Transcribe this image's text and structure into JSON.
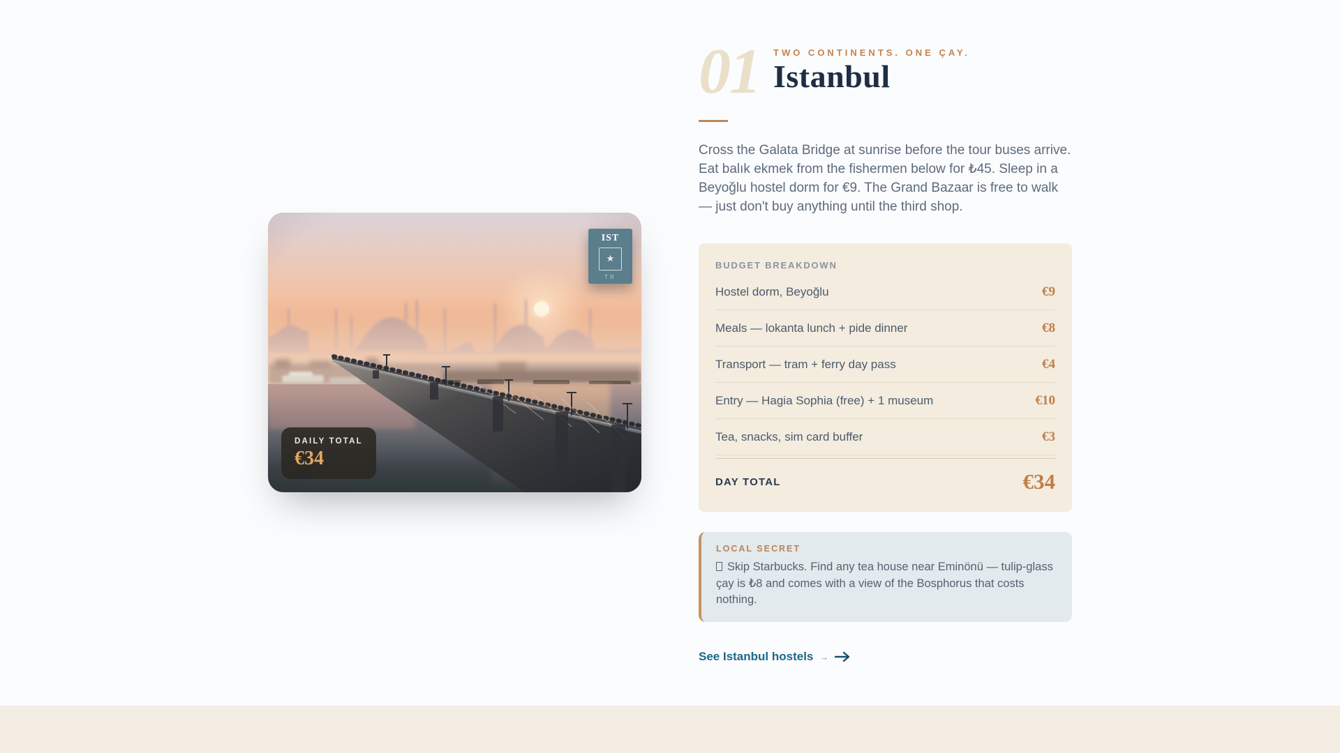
{
  "hero": {
    "index": "01",
    "kicker": "TWO CONTINENTS. ONE ÇAY.",
    "title": "Istanbul",
    "description": "Cross the Galata Bridge at sunrise before the tour buses arrive. Eat balık ekmek from the fishermen below for ₺45. Sleep in a Beyoğlu hostel dorm for €9. The Grand Bazaar is free to walk — just don't buy anything until the third shop."
  },
  "photo": {
    "alt": "Galata Bridge at hazy sunrise with mosque skyline and fishermen",
    "stamp": {
      "city_code": "IST",
      "star": "★",
      "country_code": "TR"
    },
    "overlay": {
      "label": "DAILY TOTAL",
      "amount": "€34"
    }
  },
  "budget": {
    "heading": "BUDGET BREAKDOWN",
    "items": [
      {
        "label": "Hostel dorm, Beyoğlu",
        "price": "€9"
      },
      {
        "label": "Meals — lokanta lunch + pide dinner",
        "price": "€8"
      },
      {
        "label": "Transport — tram + ferry day pass",
        "price": "€4"
      },
      {
        "label": "Entry — Hagia Sophia (free) + 1 museum",
        "price": "€10"
      },
      {
        "label": "Tea, snacks, sim card buffer",
        "price": "€3"
      }
    ],
    "total_label": "DAY TOTAL",
    "total_amount": "€34"
  },
  "secret": {
    "heading": "LOCAL SECRET",
    "text": "Skip Starbucks. Find any tea house near Eminönü — tulip-glass çay is ₺8 and comes with a view of the Bosphorus that costs nothing."
  },
  "cta": {
    "label": "See Istanbul hostels",
    "arrow": "→"
  },
  "colors": {
    "accent_orange": "#c5834e",
    "heading_navy": "#1e2e44",
    "link_teal": "#1d688a",
    "stamp_teal": "#5b7e8c",
    "card_beige": "#f3ecdf",
    "note_blue": "#e2eaee",
    "footer_strip": "#f4ede3",
    "index_cream": "#eae0ca",
    "chip_dark": "#2a2621",
    "chip_amount": "#e2a660"
  }
}
